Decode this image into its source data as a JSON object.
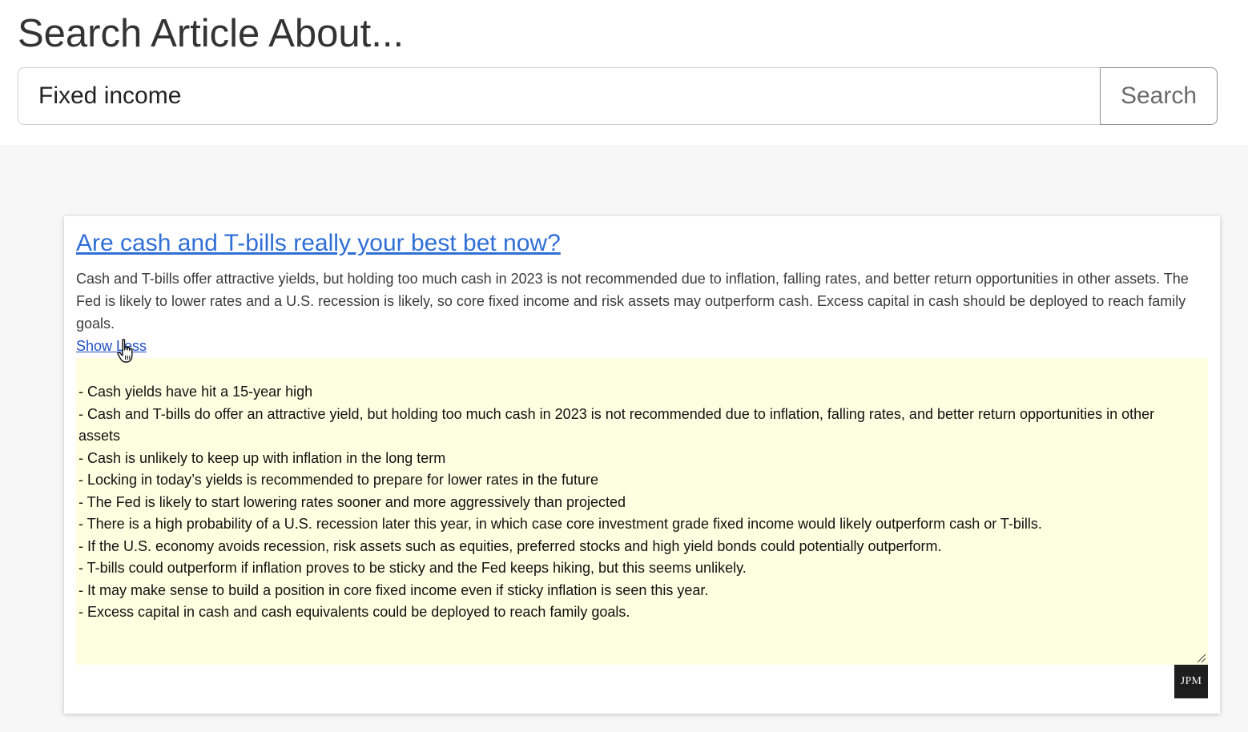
{
  "header": {
    "title": "Search Article About..."
  },
  "search": {
    "value": "Fixed income",
    "button_label": "Search"
  },
  "article": {
    "title": "Are cash and T-bills really your best bet now?",
    "summary": "Cash and T-bills offer attractive yields, but holding too much cash in 2023 is not recommended due to inflation, falling rates, and better return opportunities in other assets. The Fed is likely to lower rates and a U.S. recession is likely, so core fixed income and risk assets may outperform cash. Excess capital in cash should be deployed to reach family goals.",
    "toggle_label": "Show Less",
    "details": [
      "- Cash yields have hit a 15-year high",
      "- Cash and T-bills do offer an attractive yield, but holding too much cash in 2023 is not recommended due to inflation, falling rates, and better return opportunities in other assets",
      "- Cash is unlikely to keep up with inflation in the long term",
      "- Locking in today’s yields is recommended to prepare for lower rates in the future",
      "- The Fed is likely to start lowering rates sooner and more aggressively than projected",
      "- There is a high probability of a U.S. recession later this year, in which case core investment grade fixed income would likely outperform cash or T-bills.",
      "- If the U.S. economy avoids recession, risk assets such as equities, preferred stocks and high yield bonds could potentially outperform.",
      "- T-bills could outperform if inflation proves to be sticky and the Fed keeps hiking, but this seems unlikely.",
      "- It may make sense to build a position in core fixed income even if sticky inflation is seen this year.",
      "- Excess capital in cash and cash equivalents could be deployed to reach family goals."
    ],
    "source_badge": "JPM"
  },
  "colors": {
    "link": "#2f6fd6",
    "details_background": "#fefee1",
    "results_background": "#f7f7f7",
    "badge_background": "#1e1e1e"
  },
  "icons": {
    "cursor": "hand-pointer-icon",
    "resize": "resize-handle-icon"
  }
}
